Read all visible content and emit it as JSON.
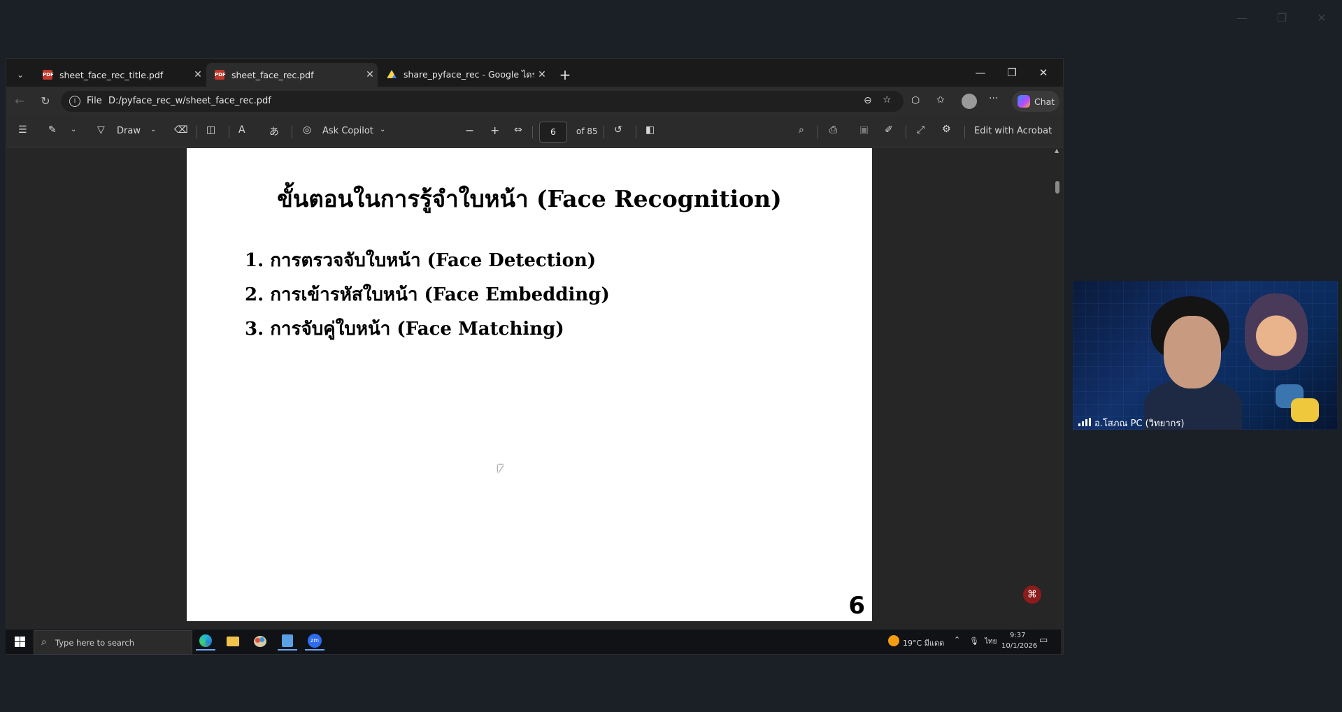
{
  "browser": {
    "tabs": [
      {
        "title": "sheet_face_rec_title.pdf",
        "icon": "pdf-icon",
        "active": false
      },
      {
        "title": "sheet_face_rec.pdf",
        "icon": "pdf-icon",
        "active": true
      },
      {
        "title": "share_pyface_rec - Google ไดรฟ์",
        "icon": "google-drive-icon",
        "active": false
      }
    ],
    "address": {
      "scheme_label": "File",
      "url": "D:/pyface_rec_w/sheet_face_rec.pdf"
    },
    "chat_label": "Chat"
  },
  "pdf_toolbar": {
    "draw_label": "Draw",
    "copilot_label": "Ask Copilot",
    "page_current": "6",
    "page_total": "of 85",
    "acrobat_label": "Edit with Acrobat"
  },
  "document": {
    "title": "ขั้นตอนในการรู้จำใบหน้า (Face Recognition)",
    "steps": [
      "1. การตรวจจับใบหน้า (Face Detection)",
      "2. การเข้ารหัสใบหน้า (Face Embedding)",
      "3. การจับคู่ใบหน้า (Face Matching)"
    ],
    "page_number": "6"
  },
  "taskbar": {
    "search_placeholder": "Type here to search",
    "weather": "19°C มีแดด",
    "language": "ไทย",
    "time": "9:37",
    "date": "10/1/2026"
  },
  "webcam": {
    "participant_name": "อ.โสภณ PC (วิทยากร)"
  },
  "colors": {
    "accent": "#6aa9ff",
    "pdf_red": "#c0392b",
    "background": "#1b1f26"
  }
}
